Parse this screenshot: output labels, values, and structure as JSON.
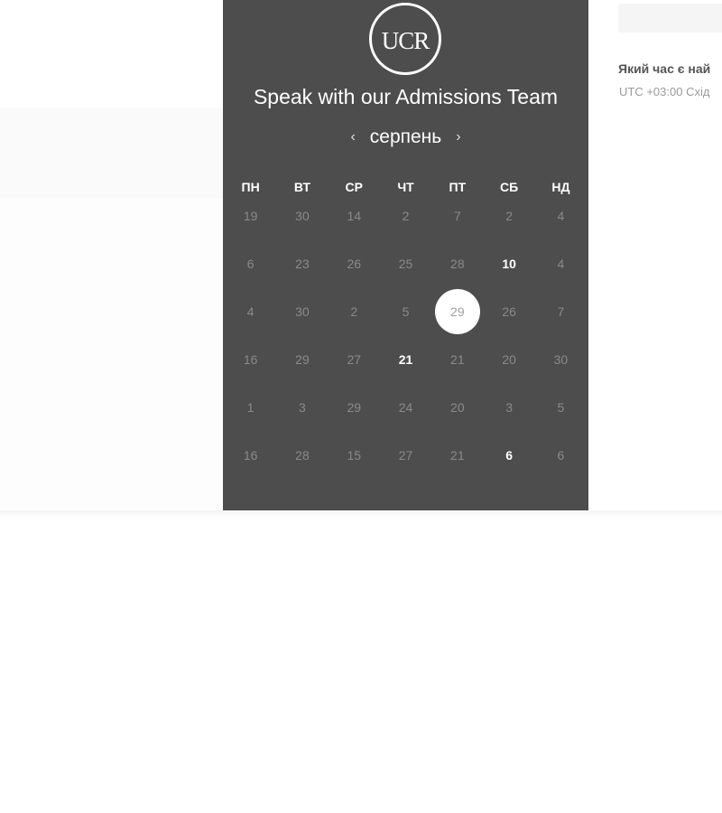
{
  "header": {
    "logo_text": "UCR",
    "title": "Speak with our Admissions Team"
  },
  "calendar": {
    "month": "серпень",
    "prev_icon": "chevron-left-icon",
    "next_icon": "chevron-right-icon",
    "weekdays": [
      "ПН",
      "ВТ",
      "СР",
      "ЧТ",
      "ПТ",
      "СБ",
      "НД"
    ],
    "weeks": [
      [
        {
          "d": "19"
        },
        {
          "d": "30"
        },
        {
          "d": "14"
        },
        {
          "d": "2"
        },
        {
          "d": "7"
        },
        {
          "d": "2"
        },
        {
          "d": "4"
        }
      ],
      [
        {
          "d": "6"
        },
        {
          "d": "23"
        },
        {
          "d": "26"
        },
        {
          "d": "25"
        },
        {
          "d": "28"
        },
        {
          "d": "10",
          "available": true
        },
        {
          "d": "4"
        }
      ],
      [
        {
          "d": "4"
        },
        {
          "d": "30"
        },
        {
          "d": "2"
        },
        {
          "d": "5"
        },
        {
          "d": "29",
          "selected": true
        },
        {
          "d": "26"
        },
        {
          "d": "7"
        }
      ],
      [
        {
          "d": "16"
        },
        {
          "d": "29"
        },
        {
          "d": "27"
        },
        {
          "d": "21",
          "available": true
        },
        {
          "d": "21"
        },
        {
          "d": "20"
        },
        {
          "d": "30"
        }
      ],
      [
        {
          "d": "1"
        },
        {
          "d": "3"
        },
        {
          "d": "29"
        },
        {
          "d": "24"
        },
        {
          "d": "20"
        },
        {
          "d": "3"
        },
        {
          "d": "5"
        }
      ],
      [
        {
          "d": "16"
        },
        {
          "d": "28"
        },
        {
          "d": "15"
        },
        {
          "d": "27"
        },
        {
          "d": "21"
        },
        {
          "d": "6",
          "available": true
        },
        {
          "d": "6"
        }
      ]
    ]
  },
  "timezone": {
    "question": "Який час є най",
    "value": "UTC +03:00 Схід"
  },
  "colors": {
    "panel": "#4d4d4d",
    "muted_day": "#8a8a8a",
    "available_day": "#ffffff"
  }
}
